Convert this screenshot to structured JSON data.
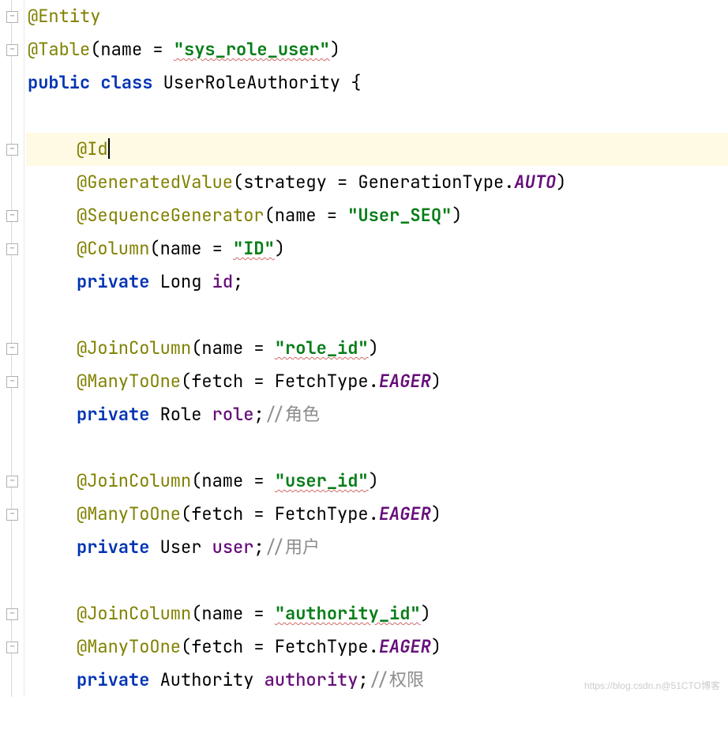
{
  "watermark": "https://blog.csdn.n@51CTO博客",
  "code": {
    "l1": {
      "ann": "@Entity"
    },
    "l2": {
      "ann": "@Table",
      "open": "(name = ",
      "str": "\"sys_role_user\"",
      "close": ")"
    },
    "l3": {
      "kw": "public class ",
      "cls": "UserRoleAuthority ",
      "brace": "{"
    },
    "l5": {
      "ann": "@Id"
    },
    "l6": {
      "ann": "@GeneratedValue",
      "open": "(strategy = GenerationType.",
      "const": "AUTO",
      "close": ")"
    },
    "l7": {
      "ann": "@SequenceGenerator",
      "open": "(name = ",
      "str": "\"User_SEQ\"",
      "close": ")"
    },
    "l8": {
      "ann": "@Column",
      "open": "(name = ",
      "str": "\"ID\"",
      "close": ")"
    },
    "l9": {
      "kw": "private ",
      "type": "Long ",
      "field": "id",
      "semi": ";"
    },
    "l11": {
      "ann": "@JoinColumn",
      "open": "(name = ",
      "str": "\"role_id\"",
      "close": ")"
    },
    "l12": {
      "ann": "@ManyToOne",
      "open": "(fetch = FetchType.",
      "const": "EAGER",
      "close": ")"
    },
    "l13": {
      "kw": "private ",
      "type": "Role ",
      "field": "role",
      "semi": ";",
      "comment": "//角色"
    },
    "l15": {
      "ann": "@JoinColumn",
      "open": "(name = ",
      "str": "\"user_id\"",
      "close": ")"
    },
    "l16": {
      "ann": "@ManyToOne",
      "open": "(fetch = FetchType.",
      "const": "EAGER",
      "close": ")"
    },
    "l17": {
      "kw": "private ",
      "type": "User ",
      "field": "user",
      "semi": ";",
      "comment": "//用户"
    },
    "l19": {
      "ann": "@JoinColumn",
      "open": "(name = ",
      "str": "\"authority_id\"",
      "close": ")"
    },
    "l20": {
      "ann": "@ManyToOne",
      "open": "(fetch = FetchType.",
      "const": "EAGER",
      "close": ")"
    },
    "l21": {
      "kw": "private ",
      "type": "Authority ",
      "field": "authority",
      "semi": ";",
      "comment": "//权限"
    }
  }
}
